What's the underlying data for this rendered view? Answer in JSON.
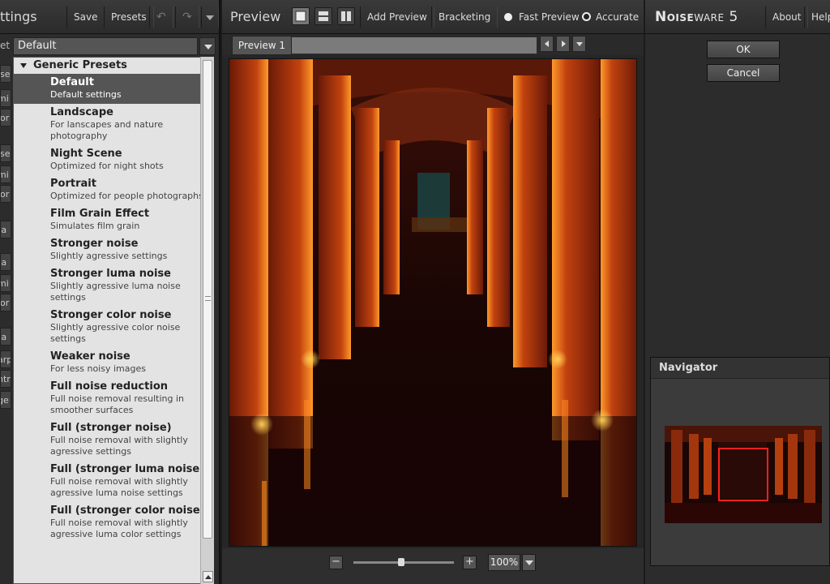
{
  "left_panel": {
    "title": "ttings",
    "save_label": "Save",
    "presets_label": "Presets",
    "preset_row_label": "et",
    "preset_selected": "Default",
    "stubs": [
      "ise",
      "mi",
      "lor",
      "ise",
      "mi",
      "lor",
      "ta",
      "ta",
      "mi",
      "lor",
      "ta",
      "arp",
      "ntr",
      "ge"
    ],
    "dropdown": {
      "group_label": "Generic Presets",
      "items": [
        {
          "name": "Default",
          "desc": "Default settings"
        },
        {
          "name": "Landscape",
          "desc": "For lanscapes and nature photography"
        },
        {
          "name": "Night Scene",
          "desc": "Optimized for night shots"
        },
        {
          "name": "Portrait",
          "desc": "Optimized for people photographs"
        },
        {
          "name": "Film Grain Effect",
          "desc": "Simulates film grain"
        },
        {
          "name": "Stronger noise",
          "desc": "Slightly agressive settings"
        },
        {
          "name": "Stronger luma noise",
          "desc": "Slightly agressive luma noise settings"
        },
        {
          "name": "Stronger color noise",
          "desc": "Slightly agressive color noise settings"
        },
        {
          "name": "Weaker noise",
          "desc": "For less noisy images"
        },
        {
          "name": "Full noise reduction",
          "desc": "Full noise removal resulting in smoother surfaces"
        },
        {
          "name": "Full (stronger noise)",
          "desc": "Full noise removal with slightly agressive settings"
        },
        {
          "name": "Full (stronger luma noise)",
          "desc": "Full noise removal with slightly agressive luma noise settings"
        },
        {
          "name": "Full (stronger color noise)",
          "desc": "Full noise removal with slightly agressive luma color settings"
        }
      ]
    }
  },
  "preview_panel": {
    "title": "Preview",
    "add_preview_label": "Add Preview",
    "bracketing_label": "Bracketing",
    "fast_preview_label": "Fast Preview",
    "accurate_label": "Accurate",
    "tab_label": "Preview 1",
    "zoom_level": "100%",
    "zoom_minus": "−",
    "zoom_plus": "+"
  },
  "right_panel": {
    "brand_bold": "Noise",
    "brand_light": "ware",
    "brand_version": "5",
    "about_label": "About",
    "help_label": "Help",
    "ok_label": "OK",
    "cancel_label": "Cancel",
    "navigator_title": "Navigator"
  },
  "colors": {
    "selection": "#555555",
    "pillar_glow": "#e0661a",
    "nav_box": "#ff2020"
  }
}
